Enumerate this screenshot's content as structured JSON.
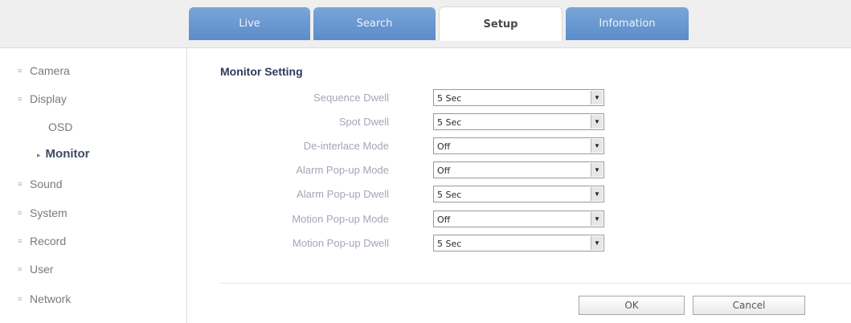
{
  "tabs": [
    {
      "label": "Live"
    },
    {
      "label": "Search"
    },
    {
      "label": "Setup"
    },
    {
      "label": "Infomation"
    }
  ],
  "sidebar": {
    "items": [
      {
        "label": "Camera"
      },
      {
        "label": "Display"
      },
      {
        "label": "Sound"
      },
      {
        "label": "System"
      },
      {
        "label": "Record"
      },
      {
        "label": "User"
      },
      {
        "label": "Network"
      }
    ],
    "sub_items": [
      {
        "label": "OSD"
      },
      {
        "label": "Monitor"
      }
    ]
  },
  "main": {
    "title": "Monitor Setting",
    "rows": [
      {
        "label": "Sequence Dwell",
        "value": "5 Sec"
      },
      {
        "label": "Spot Dwell",
        "value": "5 Sec"
      },
      {
        "label": "De-interlace Mode",
        "value": "Off"
      },
      {
        "label": "Alarm Pop-up Mode",
        "value": "Off"
      },
      {
        "label": "Alarm Pop-up Dwell",
        "value": "5 Sec"
      },
      {
        "label": "Motion Pop-up Mode",
        "value": "Off"
      },
      {
        "label": "Motion Pop-up Dwell",
        "value": "5 Sec"
      }
    ],
    "ok_label": "OK",
    "cancel_label": "Cancel"
  },
  "colors": {
    "tab_blue": "#5c8cc8",
    "title_navy": "#2f3a5c",
    "label_gray": "#a3a6b8"
  }
}
